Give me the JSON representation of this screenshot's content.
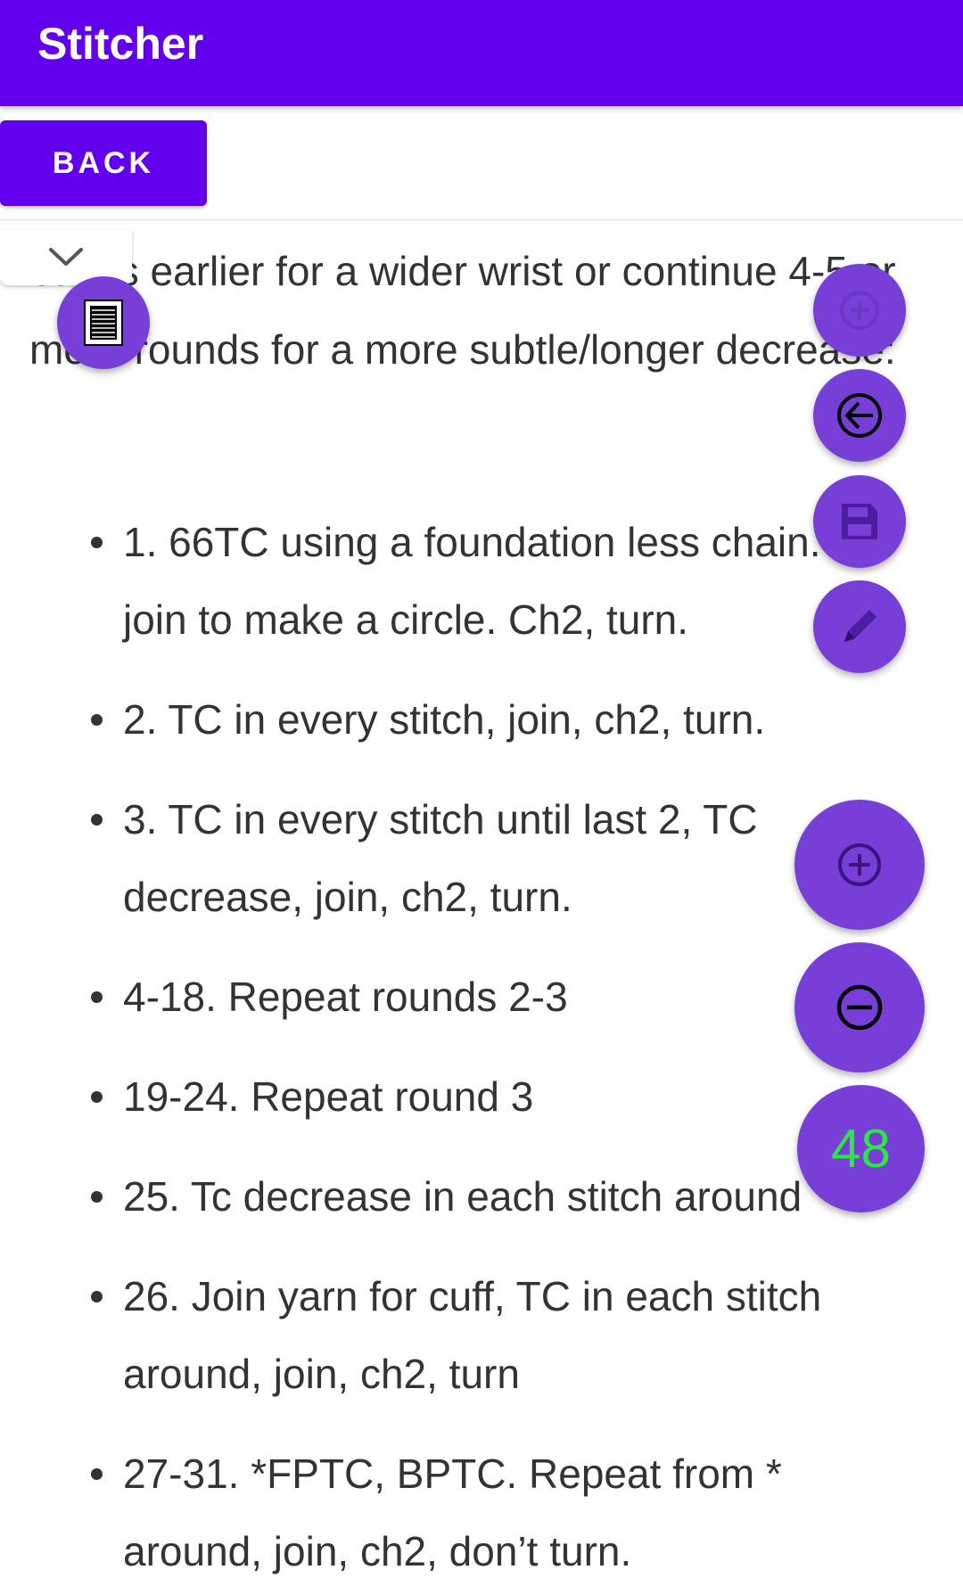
{
  "app": {
    "title": "Stitcher"
  },
  "toolbar": {
    "back_label": "BACK"
  },
  "pattern": {
    "intro": "eases earlier for a wider wrist or continue 4-5 or more rounds for a more subtle/longer decrease:",
    "steps": [
      "1. 66TC using a foundation less chain. join to make a circle. Ch2, turn.",
      "2. TC in every stitch, join, ch2, turn.",
      "3. TC in every stitch until last 2, TC decrease, join, ch2, turn.",
      "4-18. Repeat rounds 2-3",
      "19-24. Repeat round 3",
      "25. Tc decrease in each stitch around",
      "26. Join yarn for cuff, TC in each stitch around, join, ch2, turn",
      "27-31. *FPTC, BPTC. Repeat from * around, join, ch2, don’t turn."
    ]
  },
  "counter": {
    "value": "48"
  },
  "icons": {
    "collapse": "chevron-down-icon",
    "doc": "document-icon",
    "zoom_in": "plus-circle-icon",
    "back": "arrow-left-circle-icon",
    "save": "save-icon",
    "edit": "pencil-icon",
    "increment": "plus-circle-icon",
    "decrement": "minus-circle-icon"
  },
  "colors": {
    "primary": "#6200ee",
    "fab": "#773fd8",
    "counter_text": "#27ea3d",
    "text": "#333333"
  }
}
